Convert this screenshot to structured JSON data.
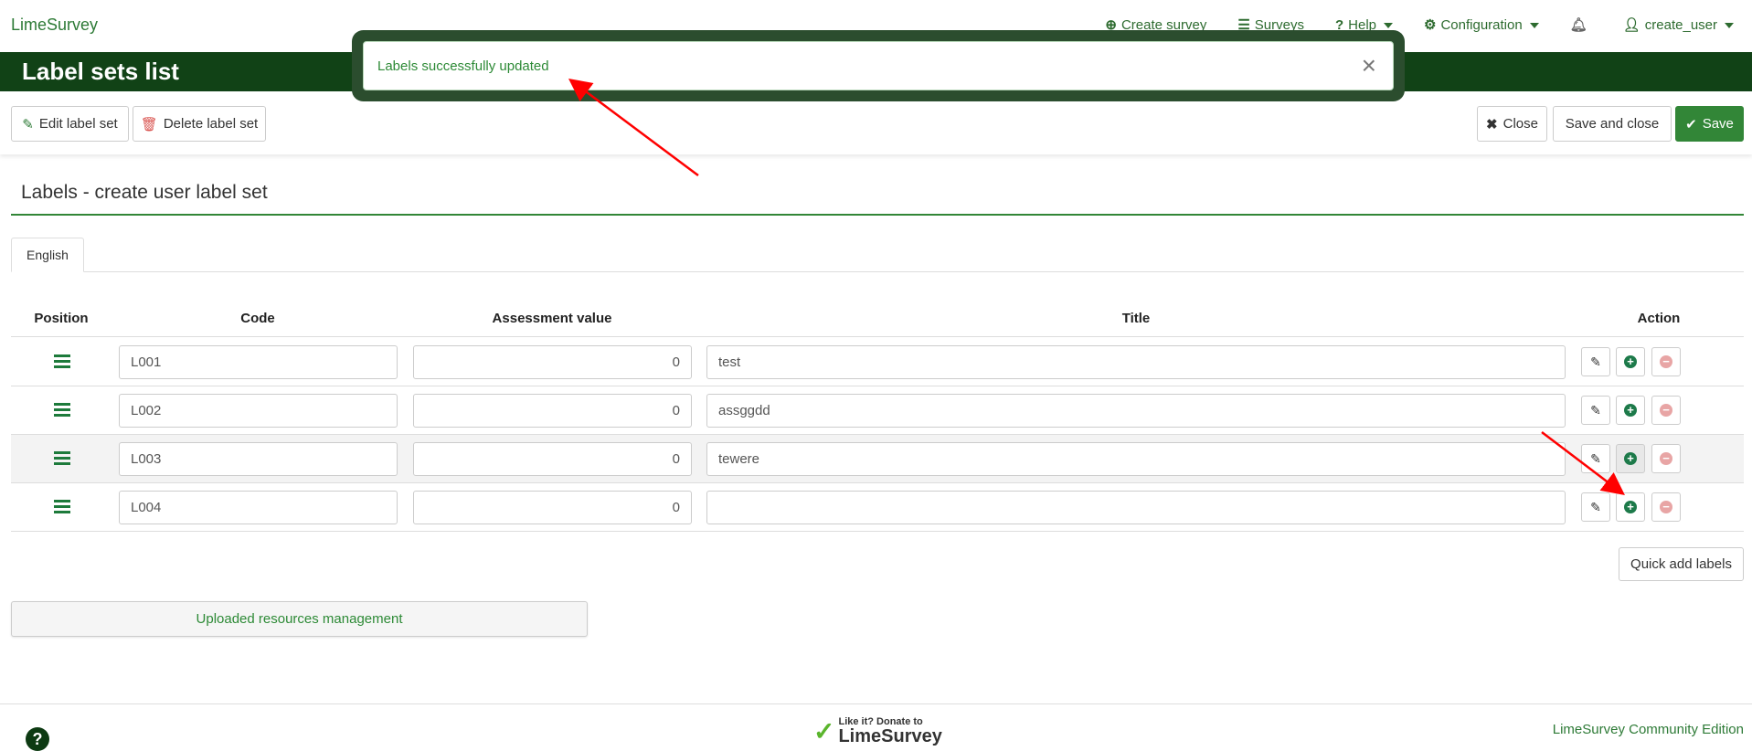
{
  "nav": {
    "brand": "LimeSurvey",
    "items": [
      {
        "label": "Create survey",
        "icon": "plus-circle-icon"
      },
      {
        "label": "Surveys",
        "icon": "list-icon"
      },
      {
        "label": "Help",
        "icon": "question-circle-icon"
      },
      {
        "label": "Configuration",
        "icon": "cogs-icon"
      },
      {
        "label": "",
        "icon": "bell-icon"
      },
      {
        "label": "create_user",
        "icon": "user-icon"
      }
    ]
  },
  "title": "Label sets list",
  "toast": {
    "message": "Labels successfully updated",
    "close": "×"
  },
  "toolbar": {
    "edit": "Edit label set",
    "delete": "Delete label set",
    "close": "Close",
    "save_close": "Save and close",
    "save": "Save"
  },
  "heading": "Labels - create user label set",
  "tab": "English",
  "table": {
    "headers": [
      "Position",
      "Code",
      "Assessment value",
      "Title",
      "Action"
    ],
    "rows": [
      {
        "code": "L001",
        "assessment": "0",
        "title": "test"
      },
      {
        "code": "L002",
        "assessment": "0",
        "title": "assggdd"
      },
      {
        "code": "L003",
        "assessment": "0",
        "title": "tewere"
      },
      {
        "code": "L004",
        "assessment": "0",
        "title": ""
      }
    ]
  },
  "quick_add": "Quick add labels",
  "uploaded": "Uploaded resources management",
  "footer": {
    "donate_line1": "Like it? Donate to",
    "donate_line2": "LimeSurvey",
    "edition": "LimeSurvey Community Edition",
    "help": "?"
  },
  "colors": {
    "brand": "#114216",
    "accent": "#328637",
    "annotation": "#ff0000"
  }
}
